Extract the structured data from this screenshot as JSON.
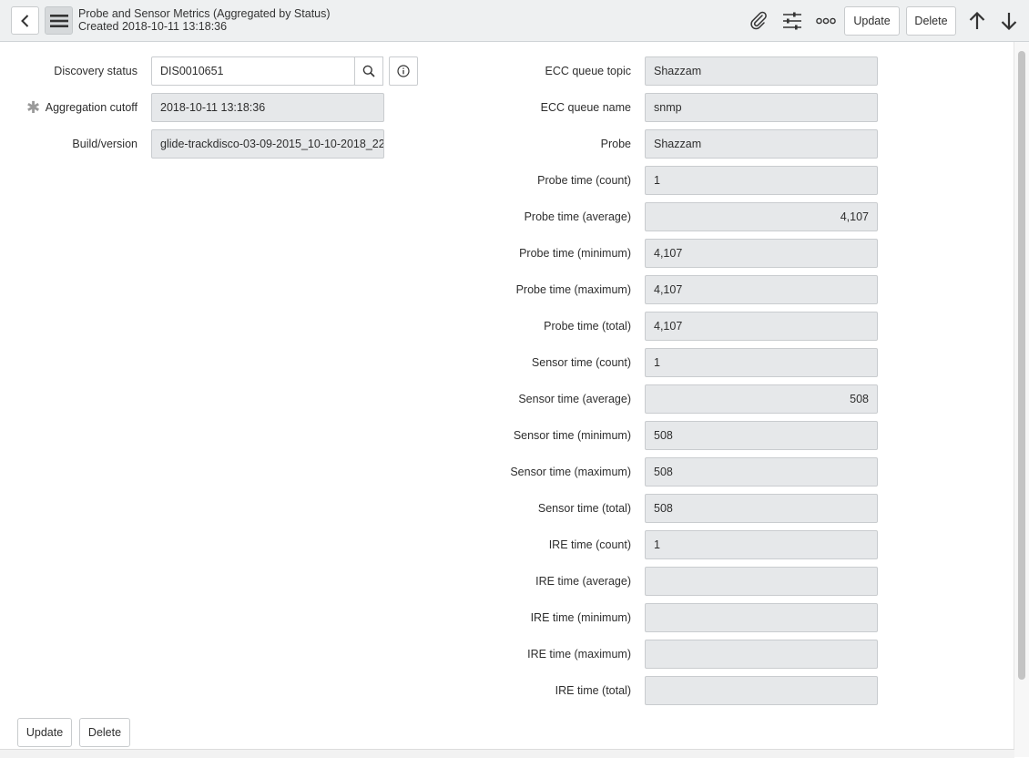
{
  "header": {
    "title": "Probe and Sensor Metrics (Aggregated by Status)",
    "subtitle": "Created 2018-10-11 13:18:36",
    "update_label": "Update",
    "delete_label": "Delete"
  },
  "left_fields": {
    "discovery_status": {
      "label": "Discovery status",
      "value": "DIS0010651"
    },
    "aggregation_cutoff": {
      "label": "Aggregation cutoff",
      "value": "2018-10-11 13:18:36",
      "mandatory_mark": "✱"
    },
    "build_version": {
      "label": "Build/version",
      "value": "glide-trackdisco-03-09-2015_10-10-2018_22"
    }
  },
  "right_fields": [
    {
      "label": "ECC queue topic",
      "value": "Shazzam",
      "align": "left"
    },
    {
      "label": "ECC queue name",
      "value": "snmp",
      "align": "left"
    },
    {
      "label": "Probe",
      "value": "Shazzam",
      "align": "left"
    },
    {
      "label": "Probe time (count)",
      "value": "1",
      "align": "left"
    },
    {
      "label": "Probe time (average)",
      "value": "4,107",
      "align": "right"
    },
    {
      "label": "Probe time (minimum)",
      "value": "4,107",
      "align": "left"
    },
    {
      "label": "Probe time (maximum)",
      "value": "4,107",
      "align": "left"
    },
    {
      "label": "Probe time (total)",
      "value": "4,107",
      "align": "left"
    },
    {
      "label": "Sensor time (count)",
      "value": "1",
      "align": "left"
    },
    {
      "label": "Sensor time (average)",
      "value": "508",
      "align": "right"
    },
    {
      "label": "Sensor time (minimum)",
      "value": "508",
      "align": "left"
    },
    {
      "label": "Sensor time (maximum)",
      "value": "508",
      "align": "left"
    },
    {
      "label": "Sensor time (total)",
      "value": "508",
      "align": "left"
    },
    {
      "label": "IRE time (count)",
      "value": "1",
      "align": "left"
    },
    {
      "label": "IRE time (average)",
      "value": "",
      "align": "right"
    },
    {
      "label": "IRE time (minimum)",
      "value": "",
      "align": "left"
    },
    {
      "label": "IRE time (maximum)",
      "value": "",
      "align": "left"
    },
    {
      "label": "IRE time (total)",
      "value": "",
      "align": "left"
    }
  ],
  "footer": {
    "update_label": "Update",
    "delete_label": "Delete"
  },
  "icons": {
    "back": "chevron-left-icon",
    "menu": "hamburger-menu-icon",
    "attach": "paperclip-icon",
    "personalize": "sliders-icon",
    "more": "more-options-icon",
    "prev": "arrow-up-icon",
    "next": "arrow-down-icon",
    "search": "search-icon",
    "info": "info-icon"
  }
}
